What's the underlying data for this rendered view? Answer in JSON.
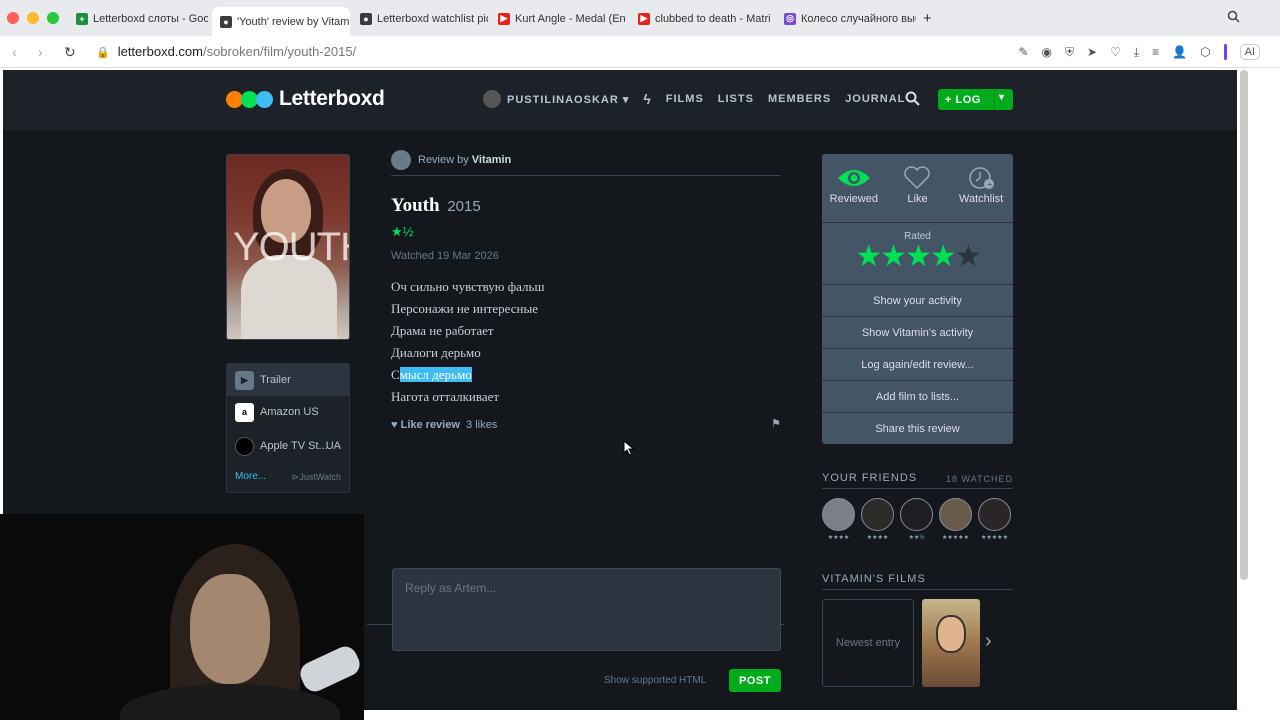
{
  "browser": {
    "tabs": [
      {
        "title": "Letterboxd слоты - Goog",
        "fav_color": "#1e8e3e",
        "fav_glyph": "+"
      },
      {
        "title": "'Youth' review by Vitamin",
        "fav_color": "#3c3c3c",
        "fav_glyph": "●",
        "active": true
      },
      {
        "title": "Letterboxd watchlist pic",
        "fav_color": "#3c3c3c",
        "fav_glyph": "●"
      },
      {
        "title": "Kurt Angle - Medal (Entr",
        "fav_color": "#e62117",
        "fav_glyph": "▶"
      },
      {
        "title": "clubbed to death - Matri",
        "fav_color": "#e62117",
        "fav_glyph": "▶"
      },
      {
        "title": "Колесо случайного выб",
        "fav_color": "#7a4bd4",
        "fav_glyph": "◎"
      }
    ],
    "url_domain": "letterboxd.com",
    "url_path": "/sobroken/film/youth-2015/",
    "ai_label": "AI"
  },
  "site": {
    "logo": "Letterboxd",
    "logo_colors": [
      "#ff8000",
      "#00e054",
      "#40bcf4"
    ],
    "username": "PUSTILINAOSKAR",
    "nav": [
      "FILMS",
      "LISTS",
      "MEMBERS",
      "JOURNAL"
    ],
    "log_button": "LOG"
  },
  "film_panel": {
    "poster_text": "YOUTH",
    "streaming": [
      {
        "label": "Trailer",
        "icon": "play-icon"
      },
      {
        "label": "Amazon US",
        "icon": "amazon-icon"
      },
      {
        "label": "Apple TV St...",
        "icon": "appletv-icon",
        "region": "UA"
      }
    ],
    "more": "More...",
    "justwatch": "JustWatch"
  },
  "review": {
    "review_by_prefix": "Review by",
    "reviewer": "Vitamin",
    "film_title": "Youth",
    "year": "2015",
    "rating_stars": "★½",
    "watched": "Watched 19 Mar 2026",
    "lines": [
      "Оч сильно чувствую фальш",
      "Персонажи не интересные",
      "Драма не работает",
      "Диалоги дерьмо",
      "Смысл дерьмо",
      "Нагота отталкивает"
    ],
    "highlight_line_prefix": "С",
    "highlight_line_selected": "мысл дерьмо",
    "like_review": "Like review",
    "likes": "3 likes",
    "reply_placeholder": "Reply as Artem...",
    "show_html": "Show supported HTML",
    "post": "POST"
  },
  "sidebar": {
    "actions": [
      "Reviewed",
      "Like",
      "Watchlist"
    ],
    "rated_label": "Rated",
    "user_rating_stars": 4,
    "buttons": [
      "Show your activity",
      "Show Vitamin's activity",
      "Log again/edit review...",
      "Add film to lists...",
      "Share this review"
    ]
  },
  "friends": {
    "heading": "YOUR FRIENDS",
    "count": "18 WATCHED",
    "ratings": [
      "★★★★",
      "★★★★",
      "★★½",
      "★★★★★",
      "★★★★★"
    ]
  },
  "vitamin_films": {
    "heading": "VITAMIN'S FILMS",
    "newest": "Newest entry"
  }
}
